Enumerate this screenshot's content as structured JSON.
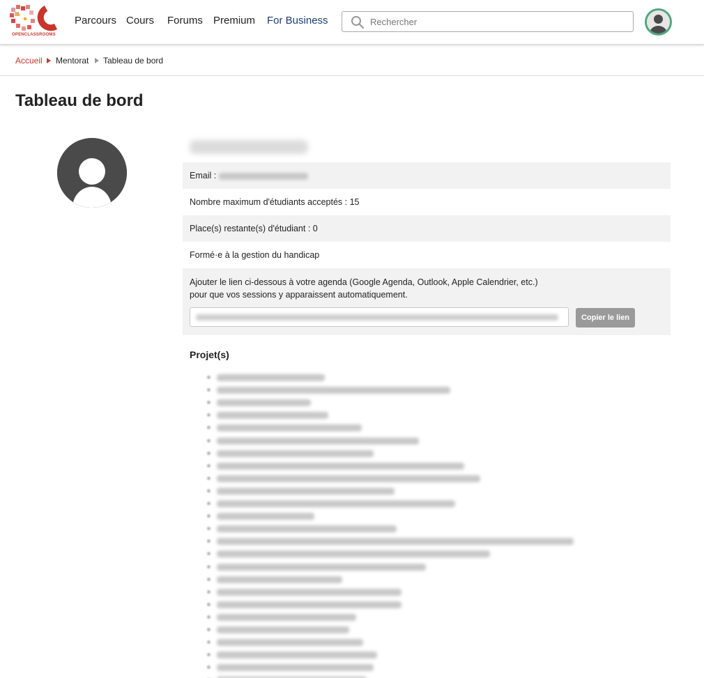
{
  "header": {
    "logo_text": "OPENCLASSROOMS",
    "nav": [
      {
        "label": "Parcours",
        "name": "nav-parcours"
      },
      {
        "label": "Cours",
        "name": "nav-cours"
      },
      {
        "label": "Forums",
        "name": "nav-forums"
      },
      {
        "label": "Premium",
        "name": "nav-premium"
      },
      {
        "label": "For Business",
        "name": "nav-for-business"
      }
    ],
    "search_placeholder": "Rechercher",
    "search_icon": "search-icon",
    "avatar_icon": "user-avatar-icon",
    "brand_color": "#c9352b",
    "business_color": "#1a3e6e",
    "avatar_ring_color": "#4fa67e"
  },
  "breadcrumb": {
    "home": "Accueil",
    "section": "Mentorat",
    "current": "Tableau de bord"
  },
  "page": {
    "title": "Tableau de bord"
  },
  "profile": {
    "avatar_icon": "user-silhouette-icon",
    "email_label": "Email :",
    "max_students_label": "Nombre maximum d'étudiants acceptés : 15",
    "remaining_label": "Place(s) restante(s) d'étudiant : 0",
    "handicap_label": "Formé·e à la gestion du handicap"
  },
  "agenda": {
    "line1": "Ajouter le lien ci-dessous à votre agenda (Google Agenda, Outlook, Apple Calendrier, etc.)",
    "line2": "pour que vos sessions y apparaissent automatiquement.",
    "copy_button": "Copier le lien"
  },
  "projects": {
    "title": "Projet(s)"
  }
}
